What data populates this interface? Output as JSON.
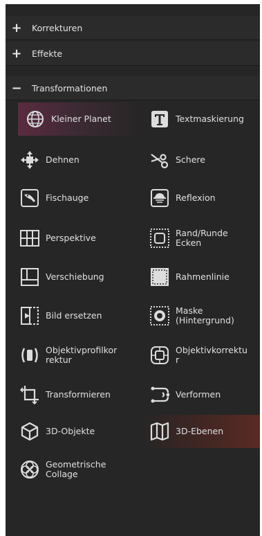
{
  "sections": [
    {
      "sign": "+",
      "label": "Korrekturen"
    },
    {
      "sign": "+",
      "label": "Effekte"
    },
    {
      "sign": "−",
      "label": "Transformationen"
    }
  ],
  "tools": {
    "kleiner_planet": {
      "label": "Kleiner Planet",
      "icon": "globe-icon"
    },
    "textmaskierung": {
      "label": "Textmaskierung",
      "icon": "text-box-icon"
    },
    "dehnen": {
      "label": "Dehnen",
      "icon": "move-arrows-icon"
    },
    "schere": {
      "label": "Schere",
      "icon": "scissors-icon"
    },
    "fischauge": {
      "label": "Fischauge",
      "icon": "fish-icon"
    },
    "reflexion": {
      "label": "Reflexion",
      "icon": "reflection-icon"
    },
    "perspektive": {
      "label": "Perspektive",
      "icon": "perspective-grid-icon"
    },
    "rand_runde_ecken": {
      "label1": "Rand/Runde",
      "label2": "Ecken",
      "icon": "rounded-border-icon"
    },
    "verschiebung": {
      "label": "Verschiebung",
      "icon": "offset-grid-icon"
    },
    "rahmenlinie": {
      "label": "Rahmenlinie",
      "icon": "frame-line-icon"
    },
    "bild_ersetzen": {
      "label": "Bild ersetzen",
      "icon": "replace-image-icon"
    },
    "maske": {
      "label1": "Maske",
      "label2": "(Hintergrund)",
      "icon": "mask-background-icon"
    },
    "objektivprofilkorrektur": {
      "label1": "Objektivprofilkor",
      "label2": "rektur",
      "icon": "lens-profile-icon"
    },
    "objektivkorrektur": {
      "label1": "Objektivkorrektu",
      "label2": "r",
      "icon": "lens-correction-icon"
    },
    "transformieren": {
      "label": "Transformieren",
      "icon": "crop-transform-icon"
    },
    "verformen": {
      "label": "Verformen",
      "icon": "warp-icon"
    },
    "objekte_3d": {
      "label": "3D-Objekte",
      "icon": "cube-icon"
    },
    "ebenen_3d": {
      "label": "3D-Ebenen",
      "icon": "map-folded-icon"
    },
    "geometrische_collage": {
      "label1": "Geometrische",
      "label2": "Collage",
      "icon": "geometric-pattern-icon"
    }
  },
  "colors": {
    "panel_bg": "#262626",
    "header_bg": "#2b2b2b",
    "selected_left": "#5a2b40",
    "selected_right": "#5a2a24"
  }
}
